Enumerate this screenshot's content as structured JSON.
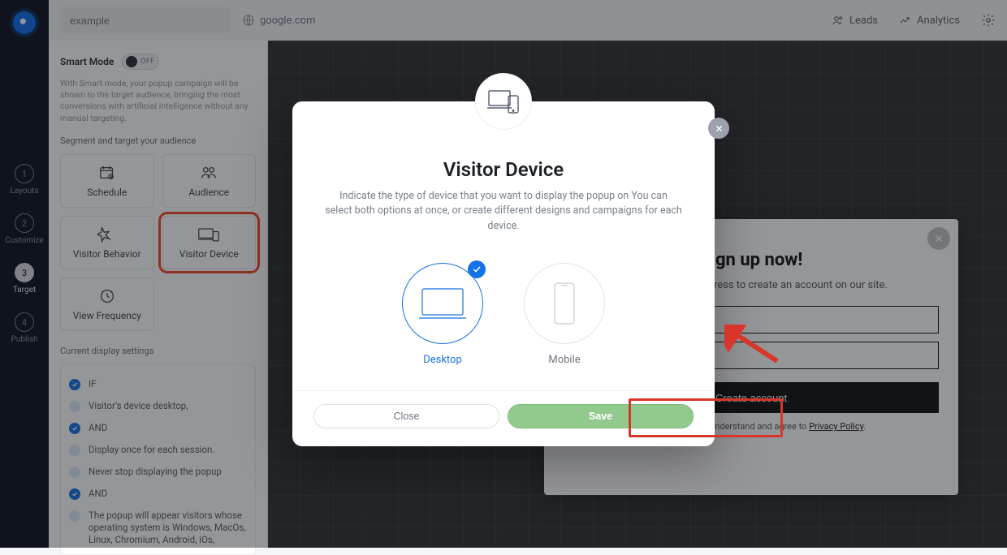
{
  "topbar": {
    "project_placeholder": "example",
    "domain": "google.com",
    "leads": "Leads",
    "analytics": "Analytics"
  },
  "rail": {
    "steps": [
      {
        "num": "1",
        "label": "Layouts"
      },
      {
        "num": "2",
        "label": "Customize"
      },
      {
        "num": "3",
        "label": "Target"
      },
      {
        "num": "4",
        "label": "Publish"
      }
    ]
  },
  "sidebar": {
    "smart_mode_label": "Smart Mode",
    "toggle_text": "OFF",
    "smart_desc": "With Smart mode, your popup campaign will be shown to the target audience, bringing the most conversions with artificial intelligence without any manual targeting.",
    "segment_label": "Segment and target your audience",
    "tiles": [
      "Schedule",
      "Audience",
      "Visitor Behavior",
      "Visitor Device",
      "View Frequency"
    ],
    "display_label": "Current display settings",
    "flow": [
      {
        "kind": "badge",
        "text": "IF"
      },
      {
        "kind": "item",
        "text": "Visitor's device desktop,"
      },
      {
        "kind": "badge",
        "text": "AND"
      },
      {
        "kind": "item",
        "text": "Display once for each session."
      },
      {
        "kind": "item",
        "text": "Never stop displaying the popup"
      },
      {
        "kind": "badge",
        "text": "AND"
      },
      {
        "kind": "item",
        "text": "The popup will appear visitors whose operating system is Windows, MacOs, Linux, Chromium, Android, iOs,"
      }
    ]
  },
  "preview": {
    "title": "Sign up now!",
    "subtitle": "Enter your e-mail address to create an account on our site.",
    "field1_ph": "",
    "field2_ph": "",
    "cta": "Create account",
    "terms_prefix": "By signing up, you understand and agree to ",
    "terms_link": "Privacy Policy",
    "terms_suffix": "."
  },
  "modal": {
    "title": "Visitor Device",
    "desc": "Indicate the type of device that you want to display the popup on You can select both options at once, or create different designs and campaigns for each device.",
    "desktop_label": "Desktop",
    "mobile_label": "Mobile",
    "close_btn": "Close",
    "save_btn": "Save"
  }
}
